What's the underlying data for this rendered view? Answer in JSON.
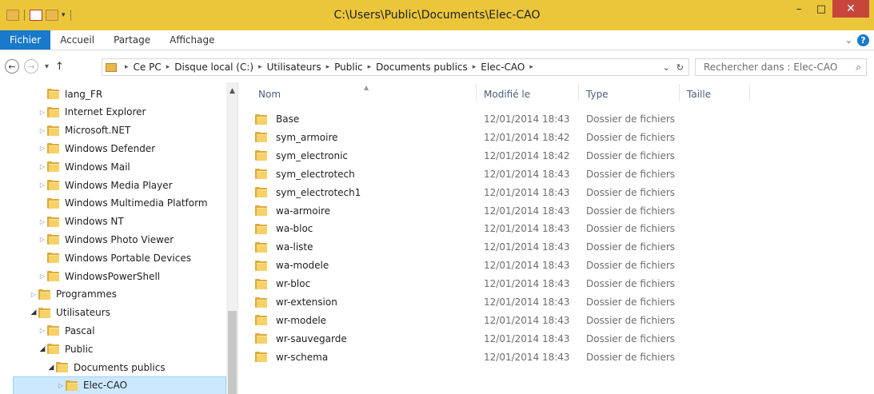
{
  "window": {
    "title": "C:\\Users\\Public\\Documents\\Elec-CAO",
    "minimize": "–",
    "maximize": "□",
    "close": "✕"
  },
  "ribbon": {
    "tabs": [
      {
        "label": "Fichier",
        "active": true
      },
      {
        "label": "Accueil"
      },
      {
        "label": "Partage"
      },
      {
        "label": "Affichage"
      }
    ],
    "collapse_icon": "chevron-down-icon",
    "help_label": "?"
  },
  "address": {
    "breadcrumbs": [
      "Ce PC",
      "Disque local (C:)",
      "Utilisateurs",
      "Public",
      "Documents publics",
      "Elec-CAO"
    ],
    "search_placeholder": "Rechercher dans : Elec-CAO"
  },
  "nav_tree": [
    {
      "label": "lang_FR",
      "indent": 3,
      "expander": ""
    },
    {
      "label": "Internet Explorer",
      "indent": 3,
      "expander": "▷"
    },
    {
      "label": "Microsoft.NET",
      "indent": 3,
      "expander": "▷"
    },
    {
      "label": "Windows Defender",
      "indent": 3,
      "expander": "▷"
    },
    {
      "label": "Windows Mail",
      "indent": 3,
      "expander": "▷"
    },
    {
      "label": "Windows Media Player",
      "indent": 3,
      "expander": "▷"
    },
    {
      "label": "Windows Multimedia Platform",
      "indent": 3,
      "expander": ""
    },
    {
      "label": "Windows NT",
      "indent": 3,
      "expander": "▷"
    },
    {
      "label": "Windows Photo Viewer",
      "indent": 3,
      "expander": "▷"
    },
    {
      "label": "Windows Portable Devices",
      "indent": 3,
      "expander": ""
    },
    {
      "label": "WindowsPowerShell",
      "indent": 3,
      "expander": "▷"
    },
    {
      "label": "Programmes",
      "indent": 2,
      "expander": "▷"
    },
    {
      "label": "Utilisateurs",
      "indent": 2,
      "expander": "◢"
    },
    {
      "label": "Pascal",
      "indent": 3,
      "expander": "▷"
    },
    {
      "label": "Public",
      "indent": 3,
      "expander": "◢"
    },
    {
      "label": "Documents publics",
      "indent": 4,
      "expander": "◢"
    },
    {
      "label": "Elec-CAO",
      "indent": 5,
      "expander": "▷",
      "selected": true
    }
  ],
  "columns": {
    "name": "Nom",
    "modified": "Modifié le",
    "type": "Type",
    "size": "Taille"
  },
  "files": [
    {
      "name": "Base",
      "modified": "12/01/2014 18:43",
      "type": "Dossier de fichiers"
    },
    {
      "name": "sym_armoire",
      "modified": "12/01/2014 18:42",
      "type": "Dossier de fichiers"
    },
    {
      "name": "sym_electronic",
      "modified": "12/01/2014 18:42",
      "type": "Dossier de fichiers"
    },
    {
      "name": "sym_electrotech",
      "modified": "12/01/2014 18:43",
      "type": "Dossier de fichiers"
    },
    {
      "name": "sym_electrotech1",
      "modified": "12/01/2014 18:43",
      "type": "Dossier de fichiers"
    },
    {
      "name": "wa-armoire",
      "modified": "12/01/2014 18:43",
      "type": "Dossier de fichiers"
    },
    {
      "name": "wa-bloc",
      "modified": "12/01/2014 18:43",
      "type": "Dossier de fichiers"
    },
    {
      "name": "wa-liste",
      "modified": "12/01/2014 18:43",
      "type": "Dossier de fichiers"
    },
    {
      "name": "wa-modele",
      "modified": "12/01/2014 18:43",
      "type": "Dossier de fichiers"
    },
    {
      "name": "wr-bloc",
      "modified": "12/01/2014 18:43",
      "type": "Dossier de fichiers"
    },
    {
      "name": "wr-extension",
      "modified": "12/01/2014 18:43",
      "type": "Dossier de fichiers"
    },
    {
      "name": "wr-modele",
      "modified": "12/01/2014 18:43",
      "type": "Dossier de fichiers"
    },
    {
      "name": "wr-sauvegarde",
      "modified": "12/01/2014 18:43",
      "type": "Dossier de fichiers"
    },
    {
      "name": "wr-schema",
      "modified": "12/01/2014 18:43",
      "type": "Dossier de fichiers"
    }
  ]
}
